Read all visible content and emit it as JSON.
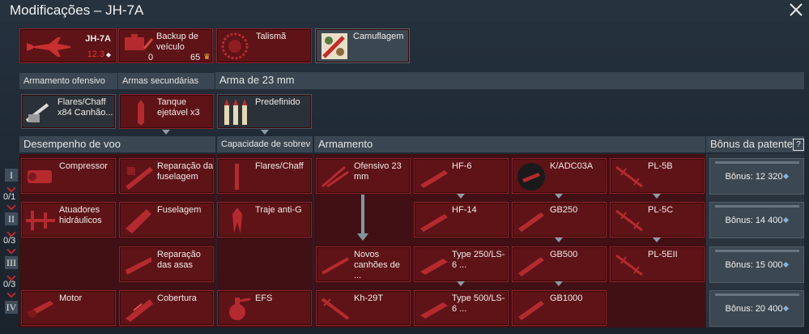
{
  "window": {
    "title": "Modificações – JH-7A"
  },
  "top": {
    "aircraft": {
      "name": "JH-7A",
      "br": "12.3"
    },
    "backup": {
      "label": "Backup de veículo",
      "count": "0",
      "cost": "65"
    },
    "talisman": {
      "label": "Talismã"
    },
    "camo": {
      "label": "Camuflagem"
    }
  },
  "weapons": {
    "offensive_header": "Armamento ofensivo",
    "secondary_header": "Armas secundárias",
    "gun_header": "Arma de 23 mm",
    "offensive_label": "Flares/Chaff x84 Canhão...",
    "secondary_label": "Tanque ejetável x3",
    "gun_label": "Predefinido"
  },
  "sections": {
    "flight": "Desempenho de voo",
    "survival": "Capacidade de sobrev",
    "armament": "Armamento",
    "rank_bonus": "Bônus da patente",
    "help": "?"
  },
  "ranks": [
    {
      "label": "I",
      "count": "0/1"
    },
    {
      "label": "II",
      "count": "0/3"
    },
    {
      "label": "III",
      "count": "0/3"
    },
    {
      "label": "IV",
      "count": ""
    }
  ],
  "flight": [
    "Compressor",
    "Reparação da fuselagem",
    "Atuadores hidráulicos",
    "Fuselagem",
    "Reparação das asas",
    "Motor",
    "Cobertura"
  ],
  "survival": [
    "Flares/Chaff",
    "Traje anti-G",
    "EFS"
  ],
  "armament": [
    "Ofensivo 23 mm",
    "Novos canhões de ...",
    "Kh-29T",
    "HF-6",
    "HF-14",
    "Type 250/LS-6 ...",
    "Type 500/LS-6 ...",
    "K/ADC03A",
    "GB250",
    "GB500",
    "GB1000",
    "PL-5B",
    "PL-5C",
    "PL-5EII"
  ],
  "bonuses": [
    "Bônus: 12 320",
    "Bônus: 14 400",
    "Bônus: 15 000",
    "Bônus: 20 400"
  ],
  "colors": {
    "card": "#5e1317",
    "card_border": "#8a2328",
    "header": "#3a4752",
    "accent_red": "#e8343a"
  }
}
